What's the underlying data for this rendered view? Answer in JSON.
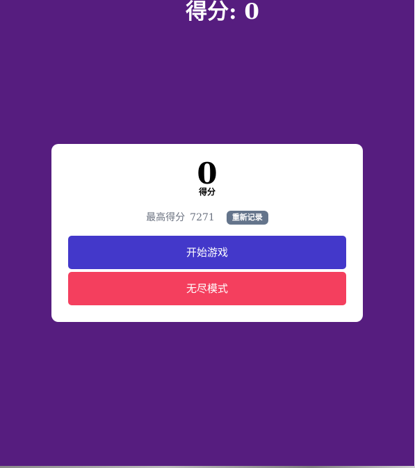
{
  "header": {
    "score_text": "得分: 0"
  },
  "result_panel": {
    "score_value": "0",
    "score_label": "得分",
    "best_label": "最高得分",
    "best_value": "7271",
    "new_record_badge": "重新记录",
    "start_button": "开始游戏",
    "endless_button": "无尽模式"
  },
  "colors": {
    "background": "#561d7f",
    "start_button": "#4338ca",
    "endless_button": "#f43f5e",
    "badge": "#64748b"
  }
}
